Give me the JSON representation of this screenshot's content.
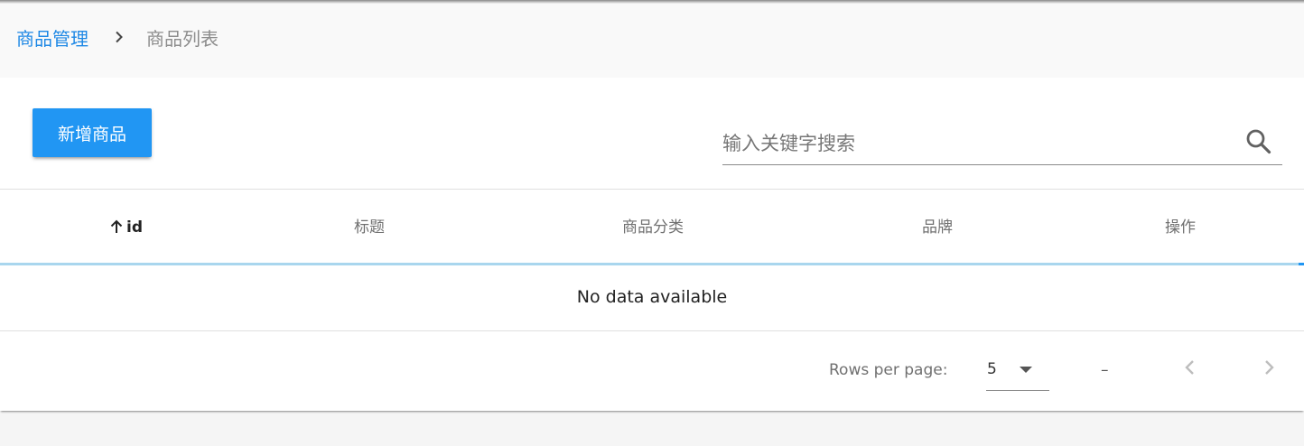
{
  "breadcrumb": {
    "parent": "商品管理",
    "current": "商品列表"
  },
  "toolbar": {
    "add_label": "新增商品",
    "search_placeholder": "输入关键字搜索"
  },
  "table": {
    "headers": [
      "id",
      "标题",
      "商品分类",
      "品牌",
      "操作"
    ],
    "sorted_column": "id",
    "sort_direction": "ascending",
    "empty_text": "No data available"
  },
  "pagination": {
    "rows_per_page_label": "Rows per page:",
    "rows_per_page_value": "5",
    "range_text": "–"
  },
  "colors": {
    "primary": "#2196f3",
    "link": "#1e88e5",
    "progress": "#a9d6ee"
  },
  "icons": {
    "breadcrumb_separator": "chevron-right-icon",
    "search": "search-icon",
    "sort": "arrow-up-icon",
    "select": "caret-down-icon",
    "prev": "chevron-left-icon",
    "next": "chevron-right-icon"
  }
}
